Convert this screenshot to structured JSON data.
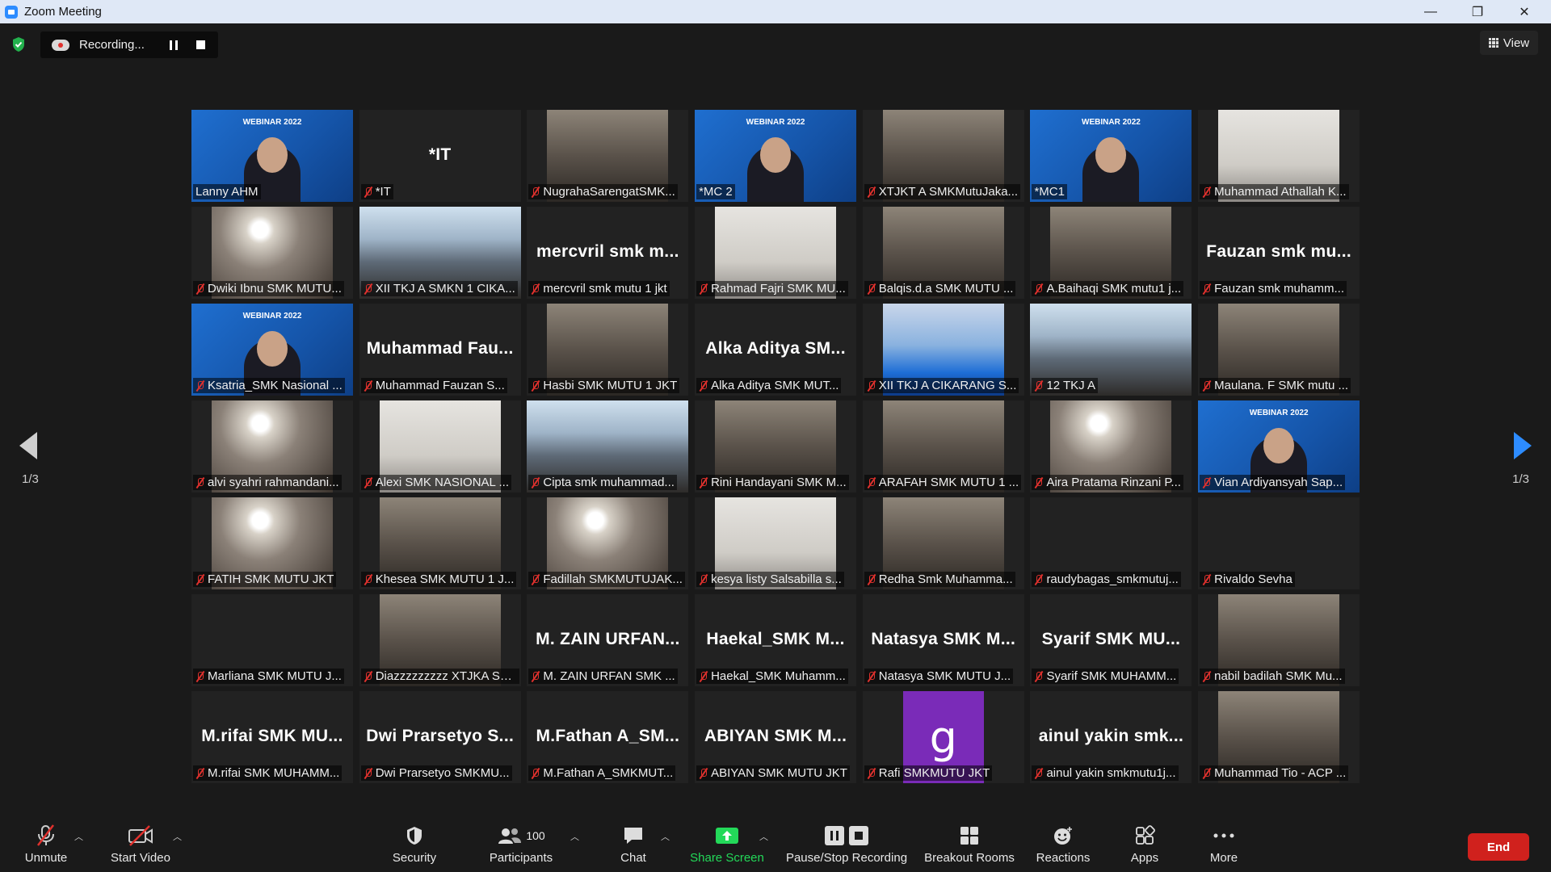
{
  "window": {
    "title": "Zoom Meeting",
    "minimize": "—",
    "restore": "❐",
    "close": "✕"
  },
  "recording": {
    "label": "Recording..."
  },
  "view_button": {
    "label": "View"
  },
  "pagination": {
    "left": "1/3",
    "right": "1/3"
  },
  "participants": [
    {
      "name": "Lanny AHM",
      "muted": false,
      "video": "webinar",
      "display": ""
    },
    {
      "name": "*IT",
      "muted": true,
      "video": "none",
      "display": "*IT"
    },
    {
      "name": "NugrahaSarengatSMK...",
      "muted": true,
      "video": "photo",
      "display": ""
    },
    {
      "name": "*MC 2",
      "muted": false,
      "video": "webinar",
      "display": "",
      "active": true
    },
    {
      "name": "XTJKT A SMKMutuJaka...",
      "muted": true,
      "video": "photo",
      "display": ""
    },
    {
      "name": "*MC1",
      "muted": false,
      "video": "webinar",
      "display": ""
    },
    {
      "name": "Muhammad Athallah K...",
      "muted": true,
      "video": "wall",
      "display": ""
    },
    {
      "name": "Dwiki Ibnu SMK MUTU...",
      "muted": true,
      "video": "light",
      "display": ""
    },
    {
      "name": "XII TKJ A SMKN 1 CIKA...",
      "muted": true,
      "video": "room",
      "display": ""
    },
    {
      "name": "mercvril smk mutu 1 jkt",
      "muted": true,
      "video": "none",
      "display": "mercvril smk m..."
    },
    {
      "name": "Rahmad Fajri SMK MU...",
      "muted": true,
      "video": "wall",
      "display": ""
    },
    {
      "name": "Balqis.d.a SMK MUTU ...",
      "muted": true,
      "video": "photo",
      "display": ""
    },
    {
      "name": "A.Baihaqi SMK mutu1 j...",
      "muted": true,
      "video": "photo",
      "display": ""
    },
    {
      "name": "Fauzan smk muhamm...",
      "muted": true,
      "video": "none",
      "display": "Fauzan smk mu..."
    },
    {
      "name": "Ksatria_SMK Nasional ...",
      "muted": true,
      "video": "webinar",
      "display": ""
    },
    {
      "name": "Muhammad Fauzan S...",
      "muted": true,
      "video": "none",
      "display": "Muhammad Fau..."
    },
    {
      "name": "Hasbi SMK MUTU 1 JKT",
      "muted": true,
      "video": "photo",
      "display": ""
    },
    {
      "name": "Alka Aditya SMK MUT...",
      "muted": true,
      "video": "none",
      "display": "Alka Aditya SM..."
    },
    {
      "name": "XII TKJ A CIKARANG S...",
      "muted": true,
      "video": "girl",
      "display": ""
    },
    {
      "name": "12 TKJ A",
      "muted": true,
      "video": "room",
      "display": ""
    },
    {
      "name": "Maulana. F SMK mutu ...",
      "muted": true,
      "video": "photo",
      "display": ""
    },
    {
      "name": "alvi syahri rahmandani...",
      "muted": true,
      "video": "light",
      "display": ""
    },
    {
      "name": "Alexi SMK NASIONAL ...",
      "muted": true,
      "video": "wall",
      "display": ""
    },
    {
      "name": "Cipta smk muhammad...",
      "muted": true,
      "video": "room",
      "display": ""
    },
    {
      "name": "Rini Handayani SMK M...",
      "muted": true,
      "video": "photo",
      "display": ""
    },
    {
      "name": "ARAFAH SMK MUTU 1 ...",
      "muted": true,
      "video": "photo",
      "display": ""
    },
    {
      "name": "Aira Pratama Rinzani P...",
      "muted": true,
      "video": "light",
      "display": ""
    },
    {
      "name": "Vian Ardiyansyah Sap...",
      "muted": true,
      "video": "webinar-full",
      "display": ""
    },
    {
      "name": "FATIH SMK MUTU JKT",
      "muted": true,
      "video": "light",
      "display": ""
    },
    {
      "name": "Khesea SMK MUTU 1 J...",
      "muted": true,
      "video": "photo",
      "display": ""
    },
    {
      "name": "Fadillah SMKMUTUJAK...",
      "muted": true,
      "video": "light",
      "display": ""
    },
    {
      "name": "kesya listy Salsabilla s...",
      "muted": true,
      "video": "wall",
      "display": ""
    },
    {
      "name": "Redha Smk Muhamma...",
      "muted": true,
      "video": "photo",
      "display": ""
    },
    {
      "name": "raudybagas_smkmutuj...",
      "muted": true,
      "video": "blank",
      "display": ""
    },
    {
      "name": "Rivaldo Sevha",
      "muted": true,
      "video": "blank",
      "display": ""
    },
    {
      "name": "Marliana SMK MUTU J...",
      "muted": true,
      "video": "blank",
      "display": ""
    },
    {
      "name": "Diazzzzzzzzz XTJKA SM...",
      "muted": true,
      "video": "photo",
      "display": ""
    },
    {
      "name": "M. ZAIN URFAN SMK ...",
      "muted": true,
      "video": "none",
      "display": "M. ZAIN URFAN..."
    },
    {
      "name": "Haekal_SMK Muhamm...",
      "muted": true,
      "video": "none",
      "display": "Haekal_SMK M..."
    },
    {
      "name": "Natasya SMK MUTU J...",
      "muted": true,
      "video": "none",
      "display": "Natasya SMK M..."
    },
    {
      "name": "Syarif SMK MUHAMM...",
      "muted": true,
      "video": "none",
      "display": "Syarif SMK MU..."
    },
    {
      "name": "nabil badilah SMK Mu...",
      "muted": true,
      "video": "photo",
      "display": ""
    },
    {
      "name": "M.rifai SMK MUHAMM...",
      "muted": true,
      "video": "none",
      "display": "M.rifai SMK MU..."
    },
    {
      "name": "Dwi Prarsetyo SMKMU...",
      "muted": true,
      "video": "none",
      "display": "Dwi Prarsetyo S..."
    },
    {
      "name": "M.Fathan A_SMKMUT...",
      "muted": true,
      "video": "none",
      "display": "M.Fathan A_SM..."
    },
    {
      "name": "ABIYAN SMK MUTU JKT",
      "muted": true,
      "video": "none",
      "display": "ABIYAN SMK M..."
    },
    {
      "name": "Rafi SMKMUTU JKT",
      "muted": true,
      "video": "purple",
      "display": "g"
    },
    {
      "name": "ainul yakin smkmutu1j...",
      "muted": true,
      "video": "none",
      "display": "ainul yakin smk..."
    },
    {
      "name": "Muhammad Tio - ACP ...",
      "muted": true,
      "video": "photo",
      "display": ""
    }
  ],
  "webinar_text": "WEBINAR 2022",
  "toolbar": {
    "unmute": "Unmute",
    "start_video": "Start Video",
    "security": "Security",
    "participants": "Participants",
    "participants_count": "100",
    "chat": "Chat",
    "share_screen": "Share Screen",
    "pause_stop": "Pause/Stop Recording",
    "breakout": "Breakout Rooms",
    "reactions": "Reactions",
    "apps": "Apps",
    "more": "More",
    "end": "End"
  },
  "colors": {
    "accent": "#2d8cff",
    "end": "#d0211d",
    "share": "#23d959",
    "active_speaker": "#d6e05a",
    "muted_red": "#e0312d"
  }
}
